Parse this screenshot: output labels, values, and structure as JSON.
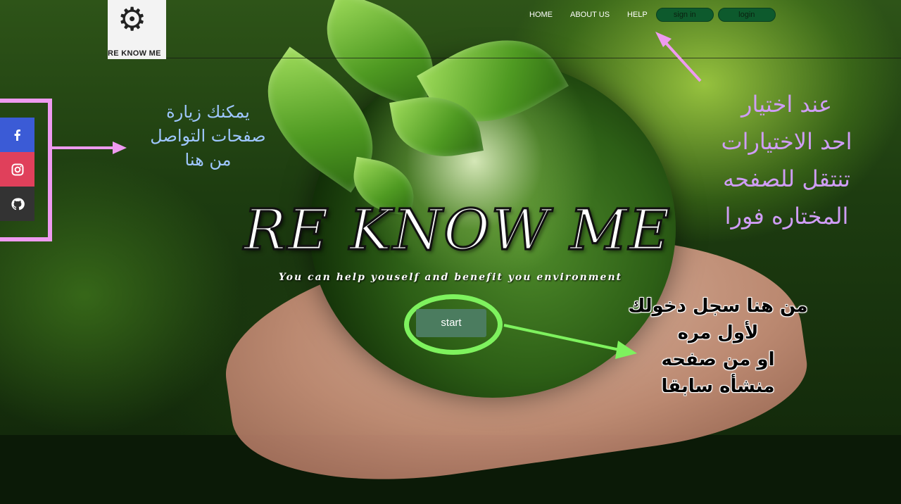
{
  "header": {
    "logo_text": "RE KNOW ME",
    "nav": {
      "home": "HOME",
      "about": "ABOUT US",
      "help": "HELP"
    },
    "buttons": {
      "signin": "sign in",
      "login": "login"
    }
  },
  "social": {
    "icons": [
      "facebook-icon",
      "instagram-icon",
      "github-icon"
    ]
  },
  "hero": {
    "title": "RE KNOW ME",
    "subtitle": "You can help youself and benefit you environment",
    "start_label": "start"
  },
  "annotations": {
    "social_note": [
      "يمكنك زيارة",
      "صفحات التواصل",
      "من هنا"
    ],
    "nav_note": [
      "عند اختيار",
      "احد الاختيارات",
      "تنتقل للصفحه",
      "المختاره فورا"
    ],
    "start_note": [
      "من هنا سجل دخولك",
      "لأول مره",
      "او من صفحه",
      "منشأه سابقا"
    ]
  },
  "colors": {
    "annotation_pink": "#ee9af0",
    "annotation_green": "#7ef25e",
    "facebook": "#3b5bd6",
    "instagram": "#e0405b",
    "github": "#333333",
    "start_button": "#4b7c5f"
  }
}
